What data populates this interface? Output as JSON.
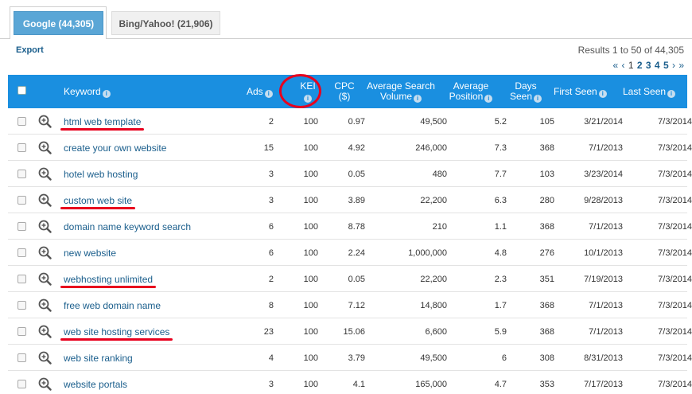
{
  "tabs": [
    {
      "label": "Google (44,305)",
      "active": true
    },
    {
      "label": "Bing/Yahoo! (21,906)",
      "active": false
    }
  ],
  "toolbar": {
    "export_label": "Export"
  },
  "results": {
    "text": "Results 1 to 50 of 44,305"
  },
  "pager": {
    "first": "«",
    "prev": "‹",
    "pages": [
      "1",
      "2",
      "3",
      "4",
      "5"
    ],
    "current": "1",
    "next": "›",
    "last": "»"
  },
  "columns": {
    "keyword": "Keyword",
    "ads": "Ads",
    "kei": "KEI",
    "cpc_1": "CPC",
    "cpc_2": "($)",
    "volume_1": "Average Search",
    "volume_2": "Volume",
    "position_1": "Average",
    "position_2": "Position",
    "days_1": "Days",
    "days_2": "Seen",
    "first_seen": "First Seen",
    "last_seen": "Last Seen",
    "info_glyph": "i"
  },
  "colors": {
    "header": "#1a8fe0",
    "link": "#1a5e8c",
    "annotation": "#e8001e"
  },
  "rows": [
    {
      "keyword": "html web template",
      "ads": "2",
      "kei": "100",
      "cpc": "0.97",
      "volume": "49,500",
      "position": "5.2",
      "days": "105",
      "first_seen": "3/21/2014",
      "last_seen": "7/3/2014",
      "underlined": true
    },
    {
      "keyword": "create your own website",
      "ads": "15",
      "kei": "100",
      "cpc": "4.92",
      "volume": "246,000",
      "position": "7.3",
      "days": "368",
      "first_seen": "7/1/2013",
      "last_seen": "7/3/2014",
      "underlined": false
    },
    {
      "keyword": "hotel web hosting",
      "ads": "3",
      "kei": "100",
      "cpc": "0.05",
      "volume": "480",
      "position": "7.7",
      "days": "103",
      "first_seen": "3/23/2014",
      "last_seen": "7/3/2014",
      "underlined": false
    },
    {
      "keyword": "custom web site",
      "ads": "3",
      "kei": "100",
      "cpc": "3.89",
      "volume": "22,200",
      "position": "6.3",
      "days": "280",
      "first_seen": "9/28/2013",
      "last_seen": "7/3/2014",
      "underlined": true
    },
    {
      "keyword": "domain name keyword search",
      "ads": "6",
      "kei": "100",
      "cpc": "8.78",
      "volume": "210",
      "position": "1.1",
      "days": "368",
      "first_seen": "7/1/2013",
      "last_seen": "7/3/2014",
      "underlined": false
    },
    {
      "keyword": "new website",
      "ads": "6",
      "kei": "100",
      "cpc": "2.24",
      "volume": "1,000,000",
      "position": "4.8",
      "days": "276",
      "first_seen": "10/1/2013",
      "last_seen": "7/3/2014",
      "underlined": false
    },
    {
      "keyword": "webhosting unlimited",
      "ads": "2",
      "kei": "100",
      "cpc": "0.05",
      "volume": "22,200",
      "position": "2.3",
      "days": "351",
      "first_seen": "7/19/2013",
      "last_seen": "7/3/2014",
      "underlined": true
    },
    {
      "keyword": "free web domain name",
      "ads": "8",
      "kei": "100",
      "cpc": "7.12",
      "volume": "14,800",
      "position": "1.7",
      "days": "368",
      "first_seen": "7/1/2013",
      "last_seen": "7/3/2014",
      "underlined": false
    },
    {
      "keyword": "web site hosting services",
      "ads": "23",
      "kei": "100",
      "cpc": "15.06",
      "volume": "6,600",
      "position": "5.9",
      "days": "368",
      "first_seen": "7/1/2013",
      "last_seen": "7/3/2014",
      "underlined": true
    },
    {
      "keyword": "web site ranking",
      "ads": "4",
      "kei": "100",
      "cpc": "3.79",
      "volume": "49,500",
      "position": "6",
      "days": "308",
      "first_seen": "8/31/2013",
      "last_seen": "7/3/2014",
      "underlined": false
    },
    {
      "keyword": "website portals",
      "ads": "3",
      "kei": "100",
      "cpc": "4.1",
      "volume": "165,000",
      "position": "4.7",
      "days": "353",
      "first_seen": "7/17/2013",
      "last_seen": "7/3/2014",
      "underlined": false
    }
  ]
}
